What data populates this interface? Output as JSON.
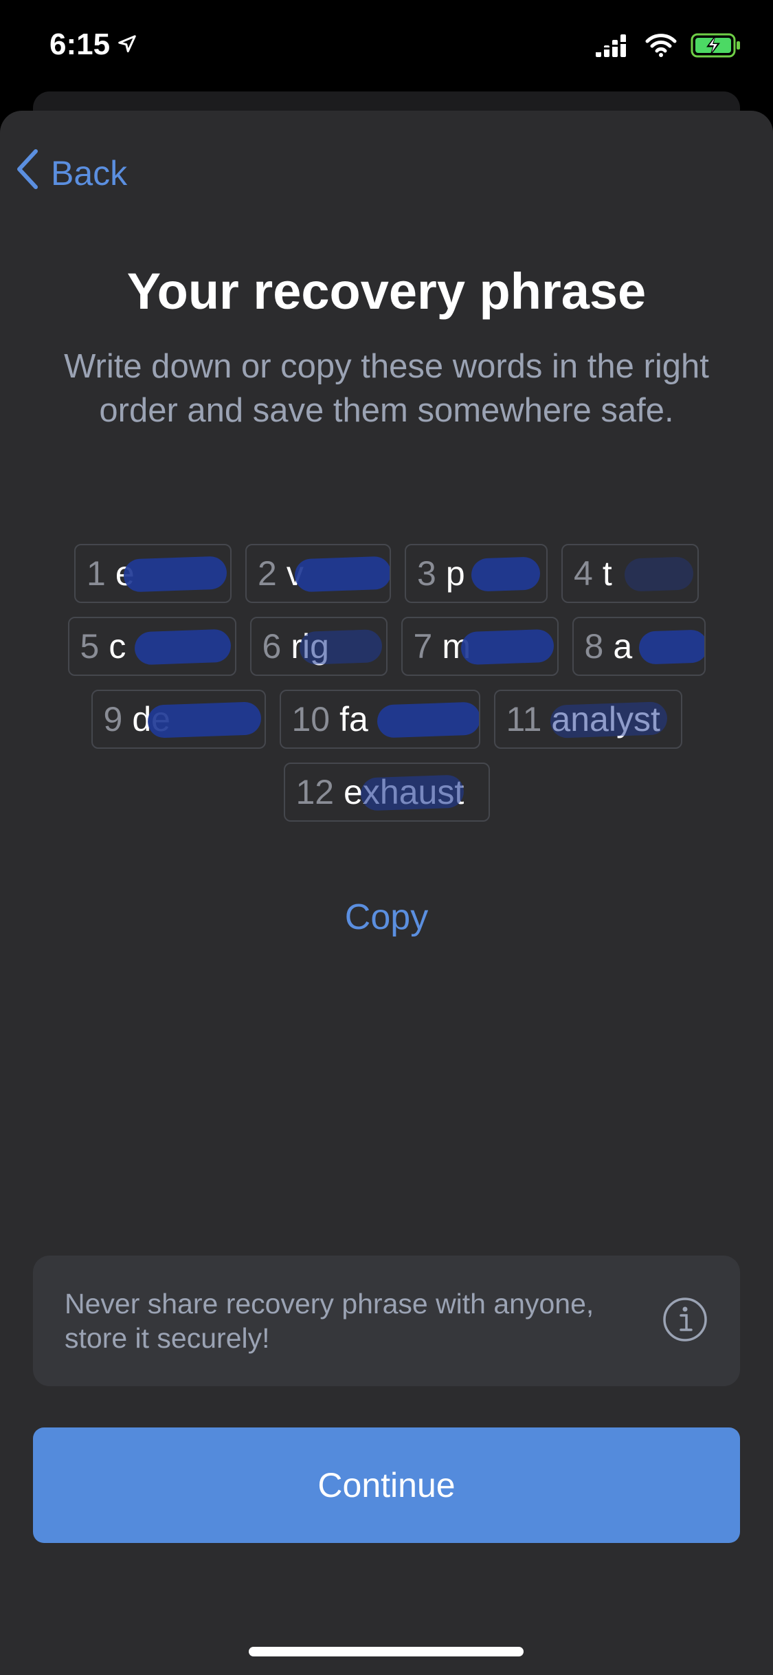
{
  "status_bar": {
    "time": "6:15"
  },
  "nav": {
    "back_label": "Back"
  },
  "header": {
    "title": "Your recovery phrase",
    "subtitle": "Write down or copy these words in the right order and save them somewhere safe."
  },
  "words": [
    {
      "num": "1",
      "text": "e"
    },
    {
      "num": "2",
      "text": "v"
    },
    {
      "num": "3",
      "text": "p"
    },
    {
      "num": "4",
      "text": "t"
    },
    {
      "num": "5",
      "text": "c"
    },
    {
      "num": "6",
      "text": "rig"
    },
    {
      "num": "7",
      "text": "m"
    },
    {
      "num": "8",
      "text": "a"
    },
    {
      "num": "9",
      "text": "de"
    },
    {
      "num": "10",
      "text": "fa"
    },
    {
      "num": "11",
      "text": "analyst"
    },
    {
      "num": "12",
      "text": "exhaust"
    }
  ],
  "actions": {
    "copy_label": "Copy",
    "continue_label": "Continue"
  },
  "warning": {
    "text": "Never share recovery phrase with anyone, store it securely!"
  },
  "colors": {
    "accent": "#548bdc",
    "link": "#5b8fe0",
    "sheet_background": "#2c2c2e",
    "redaction": "#1f3a96"
  },
  "icons": {
    "location": "location-arrow-icon",
    "signal": "cellular-signal-icon",
    "wifi": "wifi-icon",
    "battery": "battery-charging-icon",
    "back": "chevron-left-icon",
    "info": "info-icon"
  }
}
